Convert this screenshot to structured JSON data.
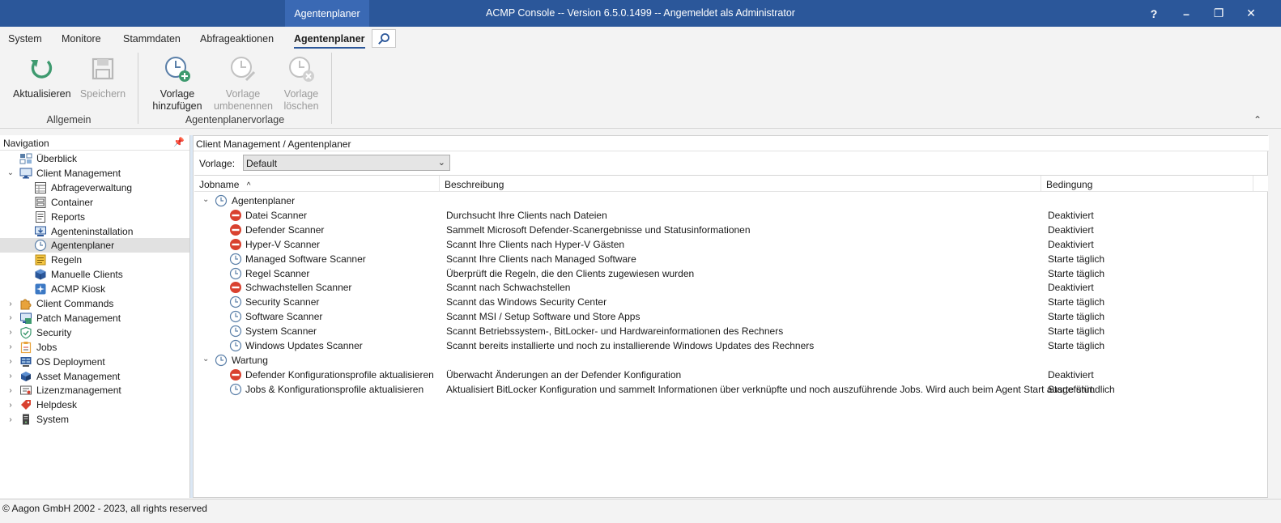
{
  "window": {
    "context_tab": "Agentenplaner",
    "title": "ACMP Console -- Version 6.5.0.1499 -- Angemeldet als Administrator",
    "help": "?",
    "minimize": "–",
    "restore": "❐",
    "close": "✕"
  },
  "ribbon_tabs": [
    {
      "label": "System"
    },
    {
      "label": "Monitore"
    },
    {
      "label": "Stammdaten"
    },
    {
      "label": "Abfrageaktionen"
    },
    {
      "label": "Agentenplaner"
    }
  ],
  "ribbon": {
    "refresh": {
      "line1": "Aktualisieren"
    },
    "save": {
      "line1": "Speichern"
    },
    "add_template": {
      "line1": "Vorlage",
      "line2": "hinzufügen"
    },
    "rename_template": {
      "line1": "Vorlage",
      "line2": "umbenennen"
    },
    "delete_template": {
      "line1": "Vorlage",
      "line2": "löschen"
    },
    "group_general": "Allgemein",
    "group_template": "Agentenplanervorlage",
    "collapse": "⌃"
  },
  "navigation": {
    "header": "Navigation",
    "items": [
      {
        "label": "Überblick",
        "icon": "overview-icon",
        "level": 1,
        "exp": ""
      },
      {
        "label": "Client Management",
        "icon": "monitor-icon",
        "level": 0,
        "exp": "⌄"
      },
      {
        "label": "Abfrageverwaltung",
        "icon": "query-icon",
        "level": 2,
        "exp": ""
      },
      {
        "label": "Container",
        "icon": "container-icon",
        "level": 2,
        "exp": ""
      },
      {
        "label": "Reports",
        "icon": "reports-icon",
        "level": 2,
        "exp": ""
      },
      {
        "label": "Agenteninstallation",
        "icon": "agent-install-icon",
        "level": 2,
        "exp": ""
      },
      {
        "label": "Agentenplaner",
        "icon": "clock-icon",
        "level": 2,
        "exp": "",
        "selected": true
      },
      {
        "label": "Regeln",
        "icon": "rules-icon",
        "level": 2,
        "exp": ""
      },
      {
        "label": "Manuelle Clients",
        "icon": "cube-icon",
        "level": 2,
        "exp": ""
      },
      {
        "label": "ACMP Kiosk",
        "icon": "kiosk-icon",
        "level": 2,
        "exp": ""
      },
      {
        "label": "Client Commands",
        "icon": "puzzle-icon",
        "level": 0,
        "exp": "›"
      },
      {
        "label": "Patch Management",
        "icon": "patch-icon",
        "level": 0,
        "exp": "›"
      },
      {
        "label": "Security",
        "icon": "shield-icon",
        "level": 0,
        "exp": "›"
      },
      {
        "label": "Jobs",
        "icon": "clipboard-icon",
        "level": 0,
        "exp": "›"
      },
      {
        "label": "OS Deployment",
        "icon": "os-deploy-icon",
        "level": 0,
        "exp": "›"
      },
      {
        "label": "Asset Management",
        "icon": "asset-icon",
        "level": 0,
        "exp": "›"
      },
      {
        "label": "Lizenzmanagement",
        "icon": "license-icon",
        "level": 0,
        "exp": "›"
      },
      {
        "label": "Helpdesk",
        "icon": "tag-icon",
        "level": 0,
        "exp": "›"
      },
      {
        "label": "System",
        "icon": "server-icon",
        "level": 0,
        "exp": "›"
      }
    ]
  },
  "main": {
    "breadcrumb": "Client Management / Agentenplaner",
    "vorlage_label": "Vorlage:",
    "vorlage_value": "Default",
    "columns": {
      "name": "Jobname",
      "desc": "Beschreibung",
      "cond": "Bedingung",
      "sort": "^"
    },
    "rows": [
      {
        "type": "group",
        "name": "Agentenplaner"
      },
      {
        "type": "job",
        "status": "disabled",
        "name": "Datei Scanner",
        "desc": "Durchsucht Ihre Clients nach Dateien",
        "cond": "Deaktiviert"
      },
      {
        "type": "job",
        "status": "disabled",
        "name": "Defender Scanner",
        "desc": "Sammelt Microsoft Defender-Scanergebnisse und Statusinformationen",
        "cond": "Deaktiviert"
      },
      {
        "type": "job",
        "status": "disabled",
        "name": "Hyper-V Scanner",
        "desc": "Scannt Ihre Clients nach Hyper-V Gästen",
        "cond": "Deaktiviert"
      },
      {
        "type": "job",
        "status": "scheduled",
        "name": "Managed Software Scanner",
        "desc": "Scannt Ihre Clients nach Managed Software",
        "cond": "Starte täglich"
      },
      {
        "type": "job",
        "status": "scheduled",
        "name": "Regel Scanner",
        "desc": "Überprüft die Regeln, die den Clients zugewiesen wurden",
        "cond": "Starte täglich"
      },
      {
        "type": "job",
        "status": "disabled",
        "name": "Schwachstellen Scanner",
        "desc": "Scannt nach Schwachstellen",
        "cond": "Deaktiviert"
      },
      {
        "type": "job",
        "status": "scheduled",
        "name": "Security Scanner",
        "desc": "Scannt das Windows Security Center",
        "cond": "Starte täglich"
      },
      {
        "type": "job",
        "status": "scheduled",
        "name": "Software Scanner",
        "desc": "Scannt MSI / Setup Software und Store Apps",
        "cond": "Starte täglich"
      },
      {
        "type": "job",
        "status": "scheduled",
        "name": "System Scanner",
        "desc": "Scannt Betriebssystem-, BitLocker- und Hardwareinformationen des Rechners",
        "cond": "Starte täglich"
      },
      {
        "type": "job",
        "status": "scheduled",
        "name": "Windows Updates Scanner",
        "desc": "Scannt bereits installierte und noch zu installierende Windows Updates des Rechners",
        "cond": "Starte täglich"
      },
      {
        "type": "group",
        "name": "Wartung"
      },
      {
        "type": "job",
        "status": "disabled",
        "name": "Defender Konfigurationsprofile aktualisieren",
        "desc": "Überwacht Änderungen an der Defender Konfiguration",
        "cond": "Deaktiviert"
      },
      {
        "type": "job",
        "status": "scheduled",
        "name": "Jobs & Konfigurationsprofile aktualisieren",
        "desc": "Aktualisiert BitLocker Konfiguration und sammelt Informationen über verknüpfte und noch auszuführende Jobs. Wird auch beim Agent Start ausgeführt.",
        "cond": "Starte stündlich"
      }
    ]
  },
  "statusbar": {
    "text": "© Aagon GmbH 2002 - 2023, all rights reserved"
  },
  "colors": {
    "accent": "#2b579a",
    "disabled_red": "#d9412f",
    "clock_blue": "#5a7fa8"
  }
}
